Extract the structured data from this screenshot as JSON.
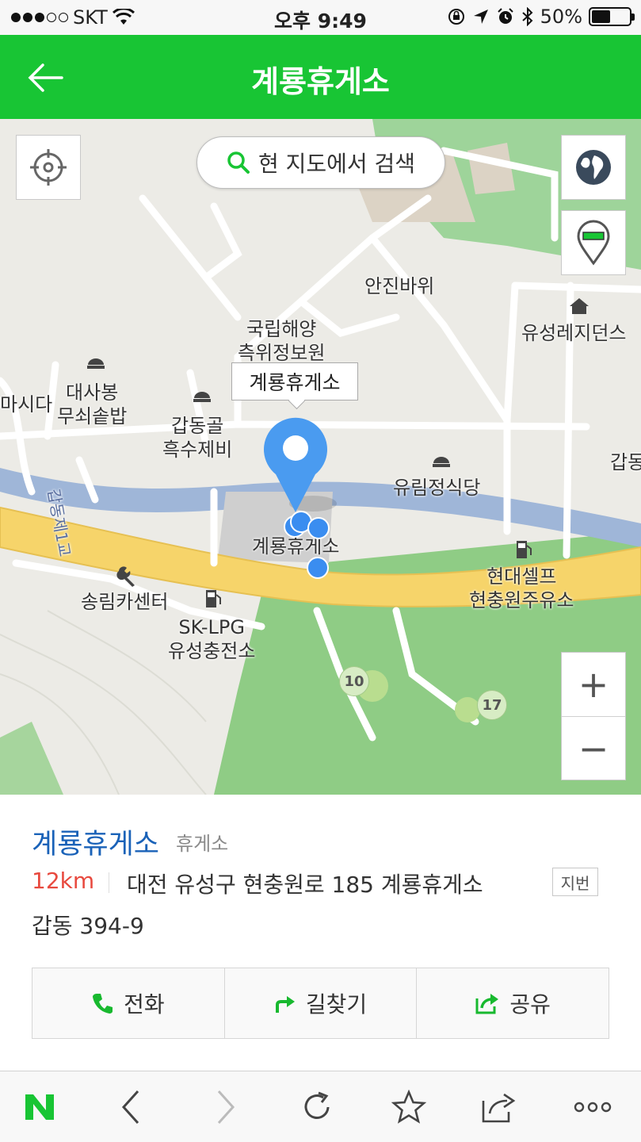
{
  "status_bar": {
    "carrier": "SKT",
    "time": "오후 9:49",
    "battery": "50%",
    "battery_level": 0.5
  },
  "header": {
    "title": "계룡휴게소",
    "back_icon": "arrow-left-icon"
  },
  "map": {
    "search_here_label": "현 지도에서 검색",
    "callout_label": "계룡휴게소",
    "zoom_in": "+",
    "zoom_out": "−",
    "labels": {
      "anjin": "안진바위",
      "kookrip": "국립해양\n측위정보원",
      "yuseong_residence": "유성레지던스",
      "daesabong": "대사봉\n무쇠솥밥",
      "masida": "마시다",
      "gapdong": "갑동골\n흑수제비",
      "gapdong_right": "갑동",
      "yurim": "유림정식당",
      "gapdong_bridge": "갑동제1교",
      "gyeryong_rest": "계룡휴게소",
      "songrim": "송림카센터",
      "sk_lpg": "SK-LPG\n유성충전소",
      "hyundai": "현대셀프\n현충원주유소",
      "hole10": "10",
      "hole17": "17"
    }
  },
  "place": {
    "name": "계룡휴게소",
    "category": "휴게소",
    "distance": "12km",
    "address": "대전 유성구 현충원로 185 계룡휴게소",
    "jibun_label": "지번",
    "address2": "갑동 394-9"
  },
  "actions": {
    "call": "전화",
    "directions": "길찾기",
    "share": "공유"
  },
  "colors": {
    "brand_green": "#18c534",
    "name_blue": "#1a62b8",
    "distance_red": "#e8493e",
    "pin_blue": "#4a9bf0"
  }
}
